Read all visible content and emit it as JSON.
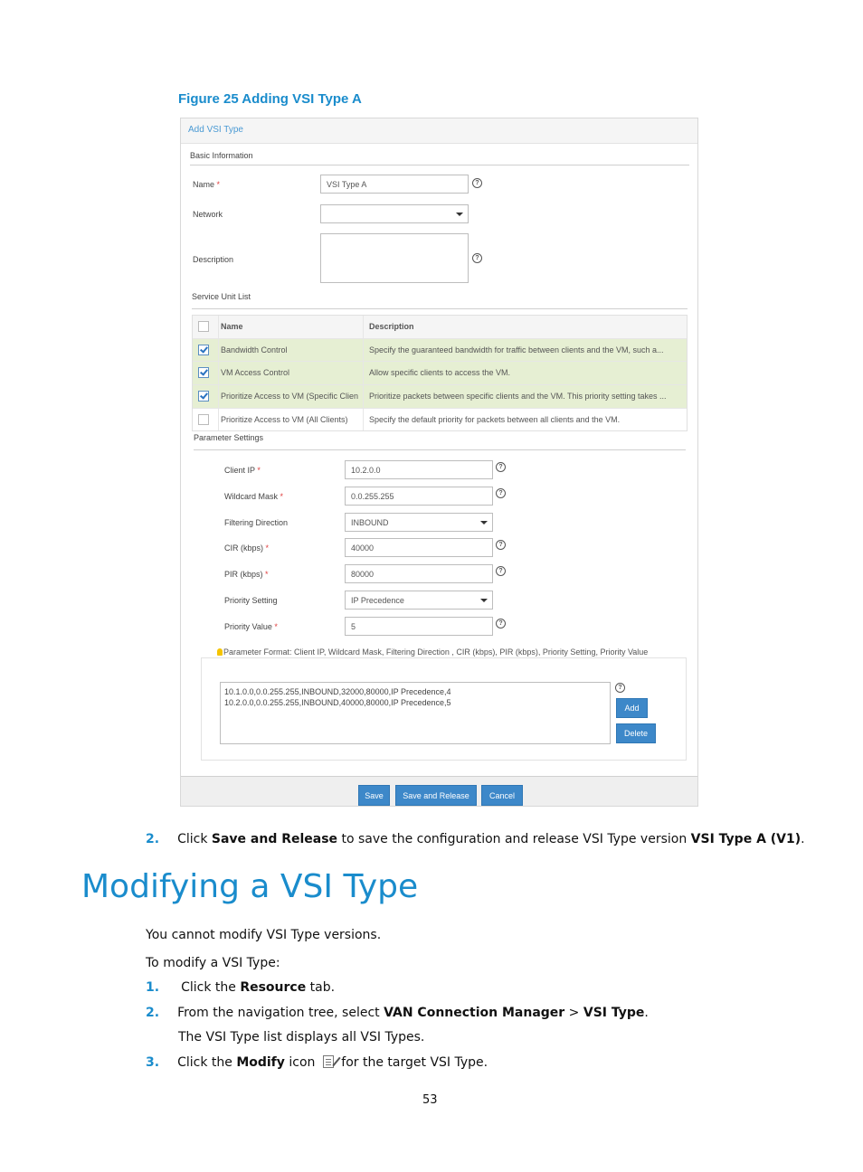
{
  "figure_caption": "Figure 25 Adding VSI Type A",
  "dialog": {
    "title": "Add VSI Type",
    "basic_section": "Basic Information",
    "name_label": "Name",
    "name_value": "VSI Type A",
    "network_label": "Network",
    "network_value": "",
    "description_label": "Description",
    "description_value": "",
    "service_section": "Service Unit List",
    "table": {
      "headers": [
        "Name",
        "Description"
      ],
      "rows": [
        {
          "checked": true,
          "name": "Bandwidth Control",
          "description": "Specify the guaranteed bandwidth for traffic between clients and the VM, such a..."
        },
        {
          "checked": true,
          "name": "VM Access Control",
          "description": "Allow specific clients to access the VM."
        },
        {
          "checked": true,
          "name": "Prioritize Access to VM (Specific Clien",
          "description": "Prioritize packets between specific clients and the VM. This priority setting takes ..."
        },
        {
          "checked": false,
          "name": "Prioritize Access to VM (All Clients)",
          "description": "Specify the default priority for packets between all clients and the VM."
        }
      ]
    },
    "param_section": "Parameter Settings",
    "params": {
      "client_ip_label": "Client IP",
      "client_ip": "10.2.0.0",
      "wildcard_label": "Wildcard Mask",
      "wildcard": "0.0.255.255",
      "direction_label": "Filtering Direction",
      "direction": "INBOUND",
      "cir_label": "CIR (kbps)",
      "cir": "40000",
      "pir_label": "PIR (kbps)",
      "pir": "80000",
      "priority_setting_label": "Priority Setting",
      "priority_setting": "IP Precedence",
      "priority_value_label": "Priority Value",
      "priority_value": "5"
    },
    "format_hint": "Parameter Format: Client IP,  Wildcard Mask,  Filtering Direction ,  CIR (kbps),  PIR (kbps),  Priority Setting,  Priority Value",
    "param_list": "10.1.0.0,0.0.255.255,INBOUND,32000,80000,IP Precedence,4\n10.2.0.0,0.0.255.255,INBOUND,40000,80000,IP Precedence,5",
    "add_label": "Add",
    "delete_label": "Delete",
    "save_label": "Save",
    "save_release_label": "Save and Release",
    "cancel_label": "Cancel",
    "required_mark": "*",
    "help_glyph": "?"
  },
  "doc": {
    "step2_num": "2.",
    "step2_a": "Click ",
    "step2_b": "Save and Release",
    "step2_c": " to save the configuration and release VSI Type version ",
    "step2_d": "VSI Type A (V1)",
    "step2_e": ".",
    "heading": "Modifying a VSI Type",
    "para1": "You cannot modify VSI Type versions.",
    "para2": "To modify a VSI Type:",
    "s1_num": "1.",
    "s1_a": "Click the ",
    "s1_b": "Resource",
    "s1_c": " tab.",
    "s2_num": "2.",
    "s2_a": "From the navigation tree, select ",
    "s2_b": "VAN Connection Manager",
    "s2_c": " > ",
    "s2_d": "VSI Type",
    "s2_e": ".",
    "s2_sub": "The VSI Type list displays all VSI Types.",
    "s3_num": "3.",
    "s3_a": "Click the ",
    "s3_b": "Modify",
    "s3_c": " icon ",
    "s3_d": " for the target VSI Type.",
    "page_number": "53"
  }
}
